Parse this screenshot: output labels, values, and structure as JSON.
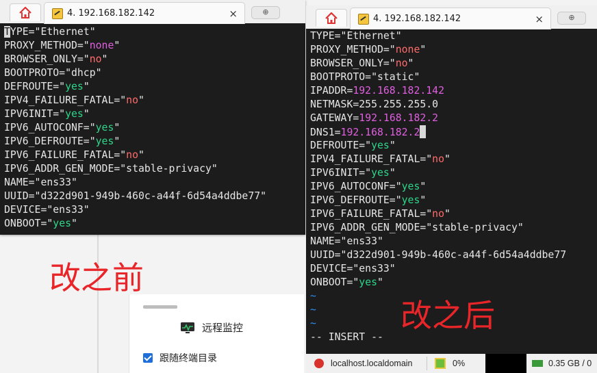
{
  "left_window": {
    "tab_title": "4. 192.168.182.142",
    "new_tab_symbol": "⊕",
    "close_symbol": "×",
    "lines": [
      [
        {
          "t": "T",
          "c": "cursor-block"
        },
        {
          "t": "YPE=\"Ethernet\"",
          "c": "k"
        }
      ],
      [
        {
          "t": "PROXY_METHOD=\"",
          "c": "k"
        },
        {
          "t": "none",
          "c": "m"
        },
        {
          "t": "\"",
          "c": "k"
        }
      ],
      [
        {
          "t": "BROWSER_ONLY=\"",
          "c": "k"
        },
        {
          "t": "no",
          "c": "r"
        },
        {
          "t": "\"",
          "c": "k"
        }
      ],
      [
        {
          "t": "BOOTPROTO=\"dhcp\"",
          "c": "k"
        }
      ],
      [
        {
          "t": "DEFROUTE=\"",
          "c": "k"
        },
        {
          "t": "yes",
          "c": "s"
        },
        {
          "t": "\"",
          "c": "k"
        }
      ],
      [
        {
          "t": "IPV4_FAILURE_FATAL=\"",
          "c": "k"
        },
        {
          "t": "no",
          "c": "r"
        },
        {
          "t": "\"",
          "c": "k"
        }
      ],
      [
        {
          "t": "IPV6INIT=\"",
          "c": "k"
        },
        {
          "t": "yes",
          "c": "s"
        },
        {
          "t": "\"",
          "c": "k"
        }
      ],
      [
        {
          "t": "IPV6_AUTOCONF=\"",
          "c": "k"
        },
        {
          "t": "yes",
          "c": "s"
        },
        {
          "t": "\"",
          "c": "k"
        }
      ],
      [
        {
          "t": "IPV6_DEFROUTE=\"",
          "c": "k"
        },
        {
          "t": "yes",
          "c": "s"
        },
        {
          "t": "\"",
          "c": "k"
        }
      ],
      [
        {
          "t": "IPV6_FAILURE_FATAL=\"",
          "c": "k"
        },
        {
          "t": "no",
          "c": "r"
        },
        {
          "t": "\"",
          "c": "k"
        }
      ],
      [
        {
          "t": "IPV6_ADDR_GEN_MODE=\"stable-privacy\"",
          "c": "k"
        }
      ],
      [
        {
          "t": "NAME=\"ens33\"",
          "c": "k"
        }
      ],
      [
        {
          "t": "UUID=\"d322d901-949b-460c-a44f-6d54a4ddbe77\"",
          "c": "k"
        }
      ],
      [
        {
          "t": "DEVICE=\"ens33\"",
          "c": "k"
        }
      ],
      [
        {
          "t": "ONBOOT=\"",
          "c": "k"
        },
        {
          "t": "yes",
          "c": "s"
        },
        {
          "t": "\"",
          "c": "k"
        }
      ]
    ]
  },
  "right_window": {
    "tab_title": "4. 192.168.182.142",
    "new_tab_symbol": "⊕",
    "close_symbol": "×",
    "lines": [
      [
        {
          "t": "TYPE=\"Ethernet\"",
          "c": "k"
        }
      ],
      [
        {
          "t": "PROXY_METHOD=\"",
          "c": "k"
        },
        {
          "t": "none",
          "c": "r"
        },
        {
          "t": "\"",
          "c": "k"
        }
      ],
      [
        {
          "t": "BROWSER_ONLY=\"",
          "c": "k"
        },
        {
          "t": "no",
          "c": "r"
        },
        {
          "t": "\"",
          "c": "k"
        }
      ],
      [
        {
          "t": "BOOTPROTO=\"static\"",
          "c": "k"
        }
      ],
      [
        {
          "t": "IPADDR=",
          "c": "k"
        },
        {
          "t": "192.168.182.142",
          "c": "m"
        }
      ],
      [
        {
          "t": "NETMASK=255.255.255.0",
          "c": "k"
        }
      ],
      [
        {
          "t": "GATEWAY=",
          "c": "k"
        },
        {
          "t": "192.168.182.2",
          "c": "m"
        }
      ],
      [
        {
          "t": "DNS1=",
          "c": "k"
        },
        {
          "t": "192.168.182.2",
          "c": "m"
        },
        {
          "t": "",
          "c": "cursor-after"
        }
      ],
      [
        {
          "t": "DEFROUTE=\"",
          "c": "k"
        },
        {
          "t": "yes",
          "c": "s"
        },
        {
          "t": "\"",
          "c": "k"
        }
      ],
      [
        {
          "t": "IPV4_FAILURE_FATAL=\"",
          "c": "k"
        },
        {
          "t": "no",
          "c": "r"
        },
        {
          "t": "\"",
          "c": "k"
        }
      ],
      [
        {
          "t": "IPV6INIT=\"",
          "c": "k"
        },
        {
          "t": "yes",
          "c": "s"
        },
        {
          "t": "\"",
          "c": "k"
        }
      ],
      [
        {
          "t": "IPV6_AUTOCONF=\"",
          "c": "k"
        },
        {
          "t": "yes",
          "c": "s"
        },
        {
          "t": "\"",
          "c": "k"
        }
      ],
      [
        {
          "t": "IPV6_DEFROUTE=\"",
          "c": "k"
        },
        {
          "t": "yes",
          "c": "s"
        },
        {
          "t": "\"",
          "c": "k"
        }
      ],
      [
        {
          "t": "IPV6_FAILURE_FATAL=\"",
          "c": "k"
        },
        {
          "t": "no",
          "c": "r"
        },
        {
          "t": "\"",
          "c": "k"
        }
      ],
      [
        {
          "t": "IPV6_ADDR_GEN_MODE=\"stable-privacy\"",
          "c": "k"
        }
      ],
      [
        {
          "t": "NAME=\"ens33\"",
          "c": "k"
        }
      ],
      [
        {
          "t": "UUID=\"d322d901-949b-460c-a44f-6d54a4ddbe77",
          "c": "k"
        }
      ],
      [
        {
          "t": "DEVICE=\"ens33\"",
          "c": "k"
        }
      ],
      [
        {
          "t": "ONBOOT=\"",
          "c": "k"
        },
        {
          "t": "yes",
          "c": "s"
        },
        {
          "t": "\"",
          "c": "k"
        }
      ],
      [
        {
          "t": "~",
          "c": "tilde"
        }
      ],
      [
        {
          "t": "~",
          "c": "tilde"
        }
      ],
      [
        {
          "t": "~",
          "c": "tilde"
        }
      ],
      [
        {
          "t": "-- INSERT --",
          "c": "w"
        }
      ]
    ]
  },
  "status_bar": {
    "host": "localhost.localdomain",
    "cpu": "0%",
    "memory": "0.35 GB / 0"
  },
  "background_panel": {
    "monitor_label": "远程监控",
    "follow_label": "跟随终端目录",
    "follow_checked": true
  },
  "annotations": {
    "before": "改之前",
    "after": "改之后"
  },
  "colors": {
    "terminal_bg": "#1c1c1c",
    "value_green": "#2fd68a",
    "value_red": "#ff6b6b",
    "value_magenta": "#e05fe0",
    "annotation_red": "#e8262a",
    "tilde_blue": "#2f8ff0"
  }
}
